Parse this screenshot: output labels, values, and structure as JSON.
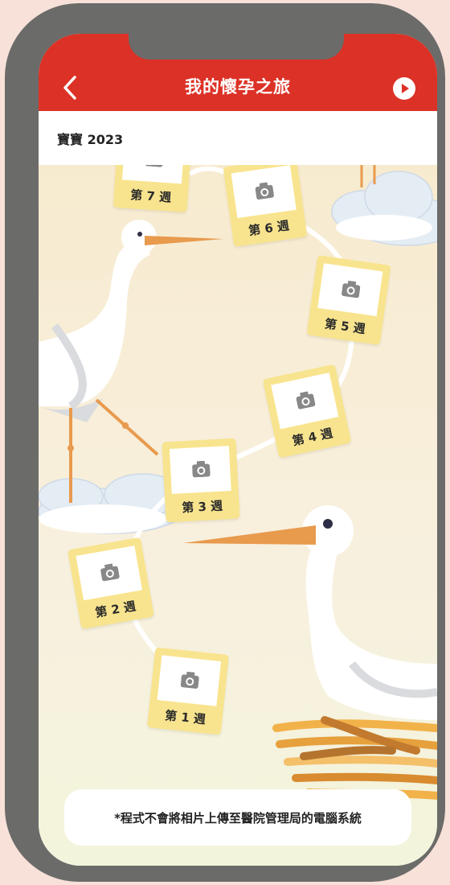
{
  "header": {
    "title": "我的懷孕之旅",
    "back_icon": "chevron-left-icon",
    "play_icon": "play-circle-icon",
    "background": "#dc3126"
  },
  "album": {
    "name": "寶寶 2023"
  },
  "weeks": [
    {
      "label": "第 1 週"
    },
    {
      "label": "第 2 週"
    },
    {
      "label": "第 3 週"
    },
    {
      "label": "第 4 週"
    },
    {
      "label": "第 5 週"
    },
    {
      "label": "第 6 週"
    },
    {
      "label": "第 7 週"
    }
  ],
  "footer": {
    "disclaimer": "*程式不會將相片上傳至醫院管理局的電腦系統"
  },
  "colors": {
    "accent": "#dc3126",
    "frame": "#f8e48e",
    "bezel": "#6b6b69"
  }
}
